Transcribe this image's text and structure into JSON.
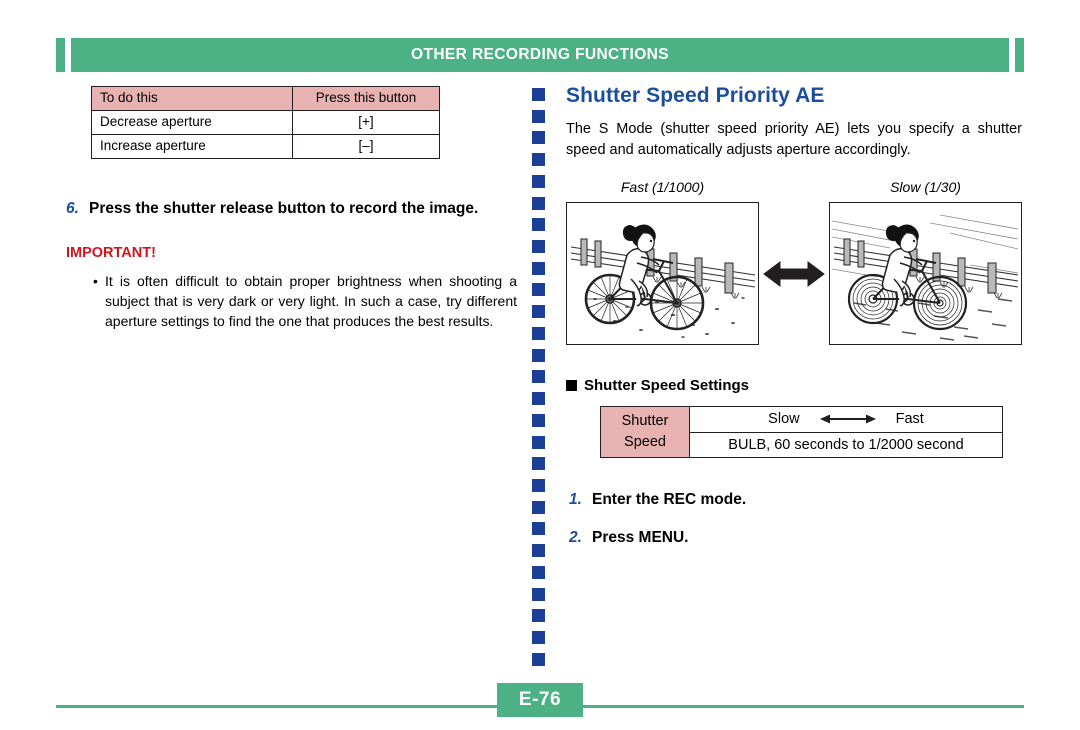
{
  "header": {
    "title": "OTHER RECORDING FUNCTIONS"
  },
  "colors": {
    "banner_green": "#4cb286",
    "heading_blue": "#1b4f9c",
    "important_red": "#d8111c",
    "table_pink": "#e8b2b2",
    "divider_blue": "#1b3f94"
  },
  "left": {
    "aperture_table": {
      "headers": [
        "To do this",
        "Press this button"
      ],
      "rows": [
        [
          "Decrease aperture",
          "[+]"
        ],
        [
          "Increase aperture",
          "[–]"
        ]
      ]
    },
    "step6": {
      "number": "6.",
      "text": "Press the shutter release button to record the image."
    },
    "important_label": "IMPORTANT!",
    "important_bullet": {
      "marker": "•",
      "text": "It is often difficult to obtain proper brightness when shooting a subject that is very dark or very light. In such a case, try different aperture settings to find the one that produces the best results."
    }
  },
  "right": {
    "section_title": "Shutter Speed Priority AE",
    "intro": "The S Mode (shutter speed priority AE) lets you specify a shutter speed and automatically adjusts aperture accordingly.",
    "figures": [
      {
        "caption": "Fast (1/1000)",
        "alt": "cyclist-sharp-illustration"
      },
      {
        "caption": "Slow (1/30)",
        "alt": "cyclist-motion-blur-illustration"
      }
    ],
    "between_figures_icon": "double-arrow-icon",
    "sub_head": "Shutter Speed Settings",
    "speed_table": {
      "label": "Shutter Speed",
      "label_line1": "Shutter",
      "label_line2": "Speed",
      "scale_left": "Slow",
      "scale_right": "Fast",
      "scale_icon": "left-right-arrow-icon",
      "range": "BULB, 60 seconds to 1/2000 second"
    },
    "steps": [
      {
        "number": "1.",
        "text": "Enter the REC mode."
      },
      {
        "number": "2.",
        "text": "Press MENU."
      }
    ]
  },
  "footer": {
    "page_number": "E-76"
  }
}
